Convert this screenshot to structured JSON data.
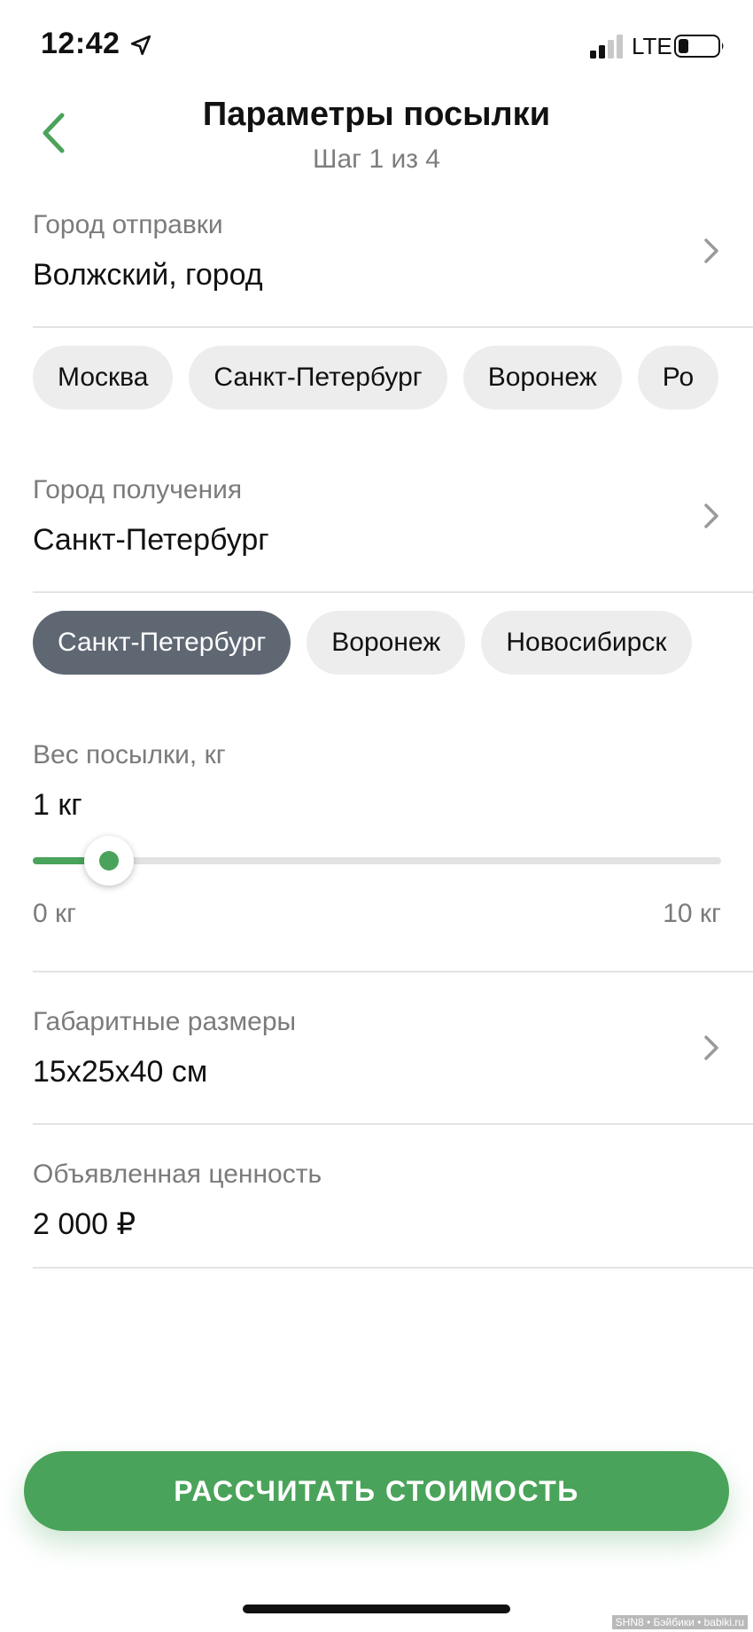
{
  "status_bar": {
    "time": "12:42",
    "network": "LTE",
    "icons": [
      "location-arrow-icon",
      "cellular-signal-icon",
      "battery-icon"
    ]
  },
  "header": {
    "back_icon": "chevron-left-icon",
    "title": "Параметры посылки",
    "subtitle": "Шаг 1 из 4"
  },
  "origin": {
    "label": "Город отправки",
    "value": "Волжский, город",
    "chips": [
      "Москва",
      "Санкт-Петербург",
      "Воронеж",
      "Ро"
    ]
  },
  "destination": {
    "label": "Город получения",
    "value": "Санкт-Петербург",
    "chips": [
      "Санкт-Петербург",
      "Воронеж",
      "Новосибирск"
    ],
    "selected_chip": 0
  },
  "weight": {
    "label": "Вес посылки, кг",
    "value": "1 кг",
    "min_label": "0 кг",
    "max_label": "10 кг",
    "min": 0,
    "max": 10,
    "current": 1
  },
  "dimensions": {
    "label": "Габаритные размеры",
    "value": "15x25x40 см"
  },
  "declared_value": {
    "label": "Объявленная ценность",
    "value": "2 000 ₽"
  },
  "action": {
    "label": "РАССЧИТАТЬ СТОИМОСТЬ"
  },
  "watermark": "SHN8 • Бэйбики • babiki.ru",
  "colors": {
    "accent": "#4aa35a",
    "chip_bg": "#ededed",
    "chip_selected_bg": "#5f6773",
    "label_gray": "#7b7b7b",
    "divider": "#e3e3e3"
  }
}
